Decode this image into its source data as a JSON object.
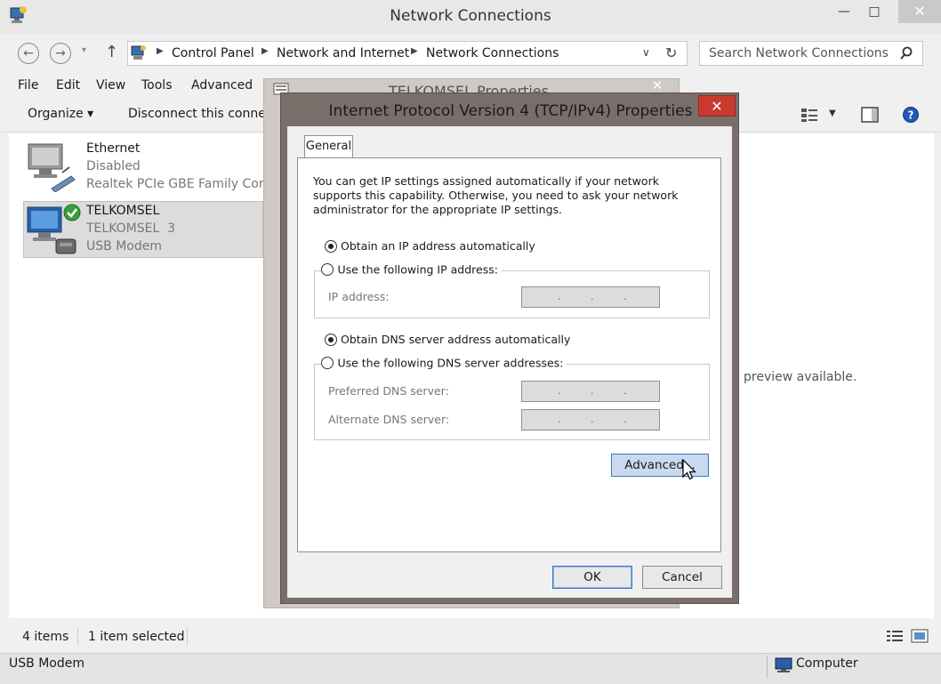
{
  "window": {
    "title": "Network Connections",
    "minimize": "—",
    "maximize": "□",
    "close": "✕"
  },
  "address": {
    "crumbs": [
      "Control Panel",
      "Network and Internet",
      "Network Connections"
    ],
    "search_placeholder": "Search Network Connections"
  },
  "menu": [
    "File",
    "Edit",
    "View",
    "Tools",
    "Advanced"
  ],
  "toolbar": {
    "organize": "Organize ▾",
    "disconnect": "Disconnect this connec"
  },
  "connections": [
    {
      "name": "Ethernet",
      "status": "Disabled",
      "device": "Realtek PCIe GBE Family Contr"
    },
    {
      "name": "TELKOMSEL",
      "status": "TELKOMSEL  3",
      "device": "USB Modem"
    }
  ],
  "preview_text": "preview available.",
  "status": {
    "items": "4 items",
    "selected": "1 item selected",
    "device": "USB Modem",
    "computer": "Computer"
  },
  "bg_dialog": {
    "title": "TELKOMSEL Properties",
    "close": "✕"
  },
  "dialog": {
    "title": "Internet Protocol Version 4 (TCP/IPv4) Properties",
    "close": "✕",
    "tab": "General",
    "description": [
      "You can get IP settings assigned automatically if your network",
      "supports this capability. Otherwise, you need to ask your network",
      "administrator for the appropriate IP settings."
    ],
    "obtain_ip": "Obtain an IP address automatically",
    "use_ip": "Use the following IP address:",
    "ip_label": "IP address:",
    "obtain_dns": "Obtain DNS server address automatically",
    "use_dns": "Use the following DNS server addresses:",
    "preferred_dns": "Preferred DNS server:",
    "alternate_dns": "Alternate DNS server:",
    "advanced": "Advanced...",
    "ok": "OK",
    "cancel": "Cancel"
  }
}
